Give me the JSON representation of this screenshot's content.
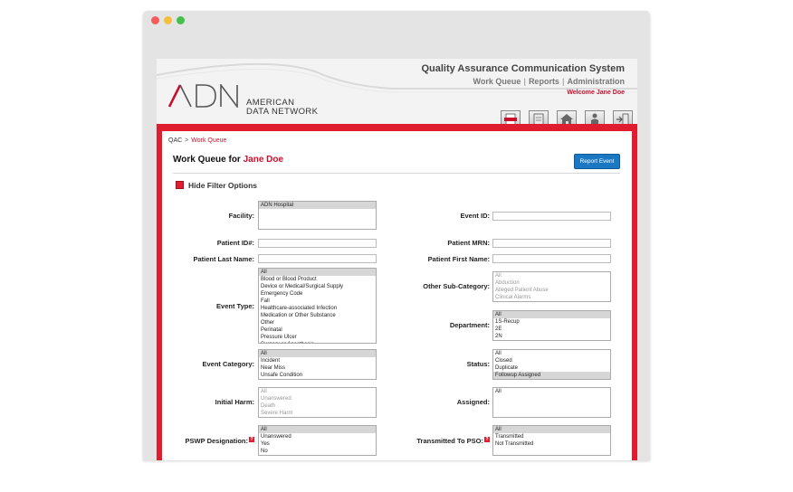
{
  "app": {
    "title": "Quality Assurance Communication System",
    "nav": [
      "Work Queue",
      "Reports",
      "Administration"
    ],
    "welcome": "Welcome Jane Doe",
    "logo_mark": "ADN",
    "logo_text_line1": "AMERICAN",
    "logo_text_line2": "DATA NETWORK",
    "toolbar_icons": [
      "pdf-icon",
      "document-icon",
      "home-icon",
      "user-icon",
      "logout-icon"
    ],
    "accent_color": "#e01d2f",
    "button_color": "#1a78c2"
  },
  "breadcrumb": {
    "root": "QAC",
    "separator": ">",
    "current": "Work Queue"
  },
  "page": {
    "heading_prefix": "Work Queue for",
    "heading_user": "Jane Doe",
    "report_button": "Report Event",
    "filter_toggle": "Hide Filter Options"
  },
  "filters": {
    "facility": {
      "label": "Facility:",
      "options": [
        "ADN Hospital"
      ],
      "selected": 0
    },
    "event_id": {
      "label": "Event ID:",
      "value": ""
    },
    "patient_id": {
      "label": "Patient ID#:",
      "value": ""
    },
    "patient_mrn": {
      "label": "Patient MRN:",
      "value": ""
    },
    "patient_last": {
      "label": "Patient Last Name:",
      "value": ""
    },
    "patient_first": {
      "label": "Patient First Name:",
      "value": ""
    },
    "event_type": {
      "label": "Event Type:",
      "options": [
        "All",
        "Blood or Blood Product",
        "Device or Medical/Surgical Supply",
        "Emergency Code",
        "Fall",
        "Healthcare-associated Infection",
        "Medication or Other Substance",
        "Other",
        "Perinatal",
        "Pressure Ulcer",
        "Surgery or Anesthesia"
      ],
      "selected": 0
    },
    "other_sub_category": {
      "label": "Other Sub-Category:",
      "options": [
        "All",
        "Abduction",
        "Alleged Patient Abuse",
        "Clinical Alarms"
      ],
      "selected": -1,
      "disabled": true
    },
    "department": {
      "label": "Department:",
      "options": [
        "All",
        "1S-Recup",
        "2E",
        "2N"
      ],
      "selected": 0
    },
    "event_category": {
      "label": "Event Category:",
      "options": [
        "All",
        "Incident",
        "Near Miss",
        "Unsafe Condition"
      ],
      "selected": 0
    },
    "status": {
      "label": "Status:",
      "options": [
        "All",
        "Closed",
        "Duplicate",
        "Followup Assigned"
      ],
      "selected": 3
    },
    "initial_harm": {
      "label": "Initial Harm:",
      "options": [
        "All",
        "Unanswered",
        "Death",
        "Severe Harm"
      ],
      "selected": -1,
      "disabled": true
    },
    "assigned": {
      "label": "Assigned:",
      "options": [
        "All"
      ],
      "selected": -1
    },
    "pswp": {
      "label": "PSWP Designation:",
      "help": "?",
      "options": [
        "All",
        "Unanswered",
        "Yes",
        "No"
      ],
      "selected": 0
    },
    "transmitted": {
      "label": "Transmitted To PSO:",
      "help": "?",
      "options": [
        "All",
        "Transmitted",
        "Not Transmitted"
      ],
      "selected": 0
    }
  }
}
